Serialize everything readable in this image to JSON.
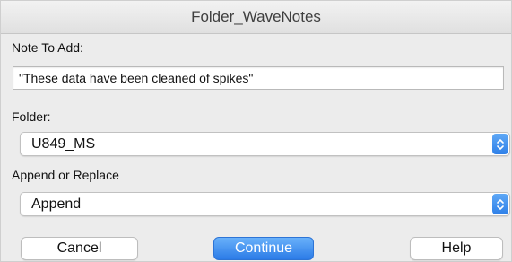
{
  "window": {
    "title": "Folder_WaveNotes"
  },
  "note": {
    "label": "Note To Add:",
    "value": "\"These data have been cleaned of spikes\""
  },
  "folder": {
    "label": "Folder:",
    "selected": "U849_MS"
  },
  "mode": {
    "label": "Append or Replace",
    "selected": "Append"
  },
  "buttons": {
    "cancel": "Cancel",
    "continue": "Continue",
    "help": "Help"
  },
  "icons": {
    "popup_stepper": "updown-chevron-icon"
  },
  "colors": {
    "accent": "#2f80e8",
    "window_bg": "#ececec"
  }
}
